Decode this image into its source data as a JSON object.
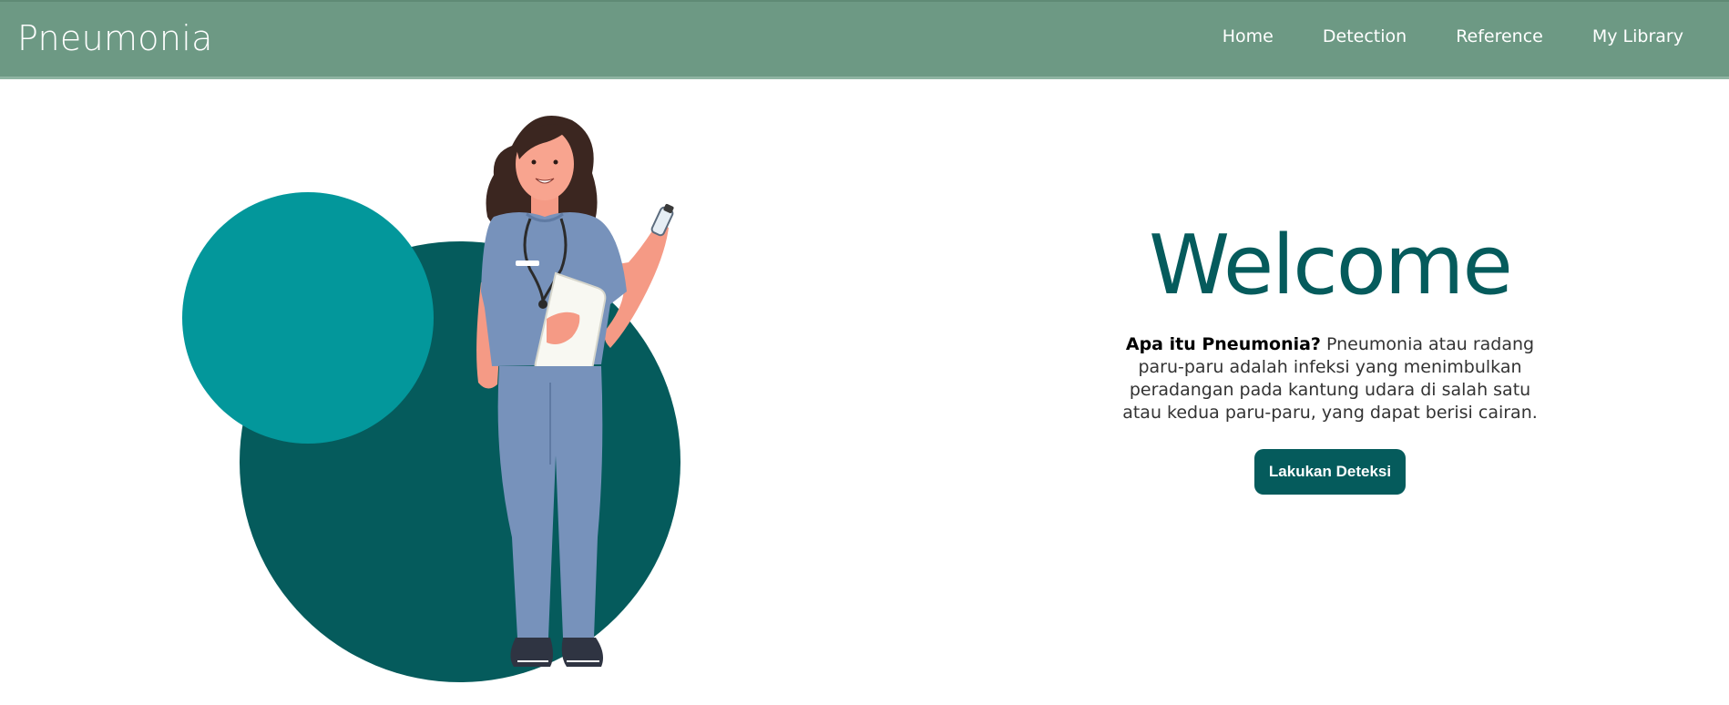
{
  "app": {
    "brand": "Pneumonia"
  },
  "nav": {
    "items": [
      {
        "label": "Home"
      },
      {
        "label": "Detection"
      },
      {
        "label": "Reference"
      },
      {
        "label": "My Library"
      }
    ]
  },
  "hero": {
    "title": "Welcome",
    "question": "Apa itu Pneumonia?",
    "description": " Pneumonia atau radang paru-paru adalah infeksi yang menimbulkan peradangan pada kantung udara di salah satu atau kedua paru-paru, yang dapat berisi cairan.",
    "cta_label": "Lakukan Deteksi"
  },
  "colors": {
    "navbar": "#6d9984",
    "accent": "#055b5c",
    "circle_light": "#03979b",
    "circle_dark": "#055b5c",
    "scrubs": "#7792bb"
  },
  "illustration": {
    "icon": "doctor-with-clipboard-illustration"
  }
}
